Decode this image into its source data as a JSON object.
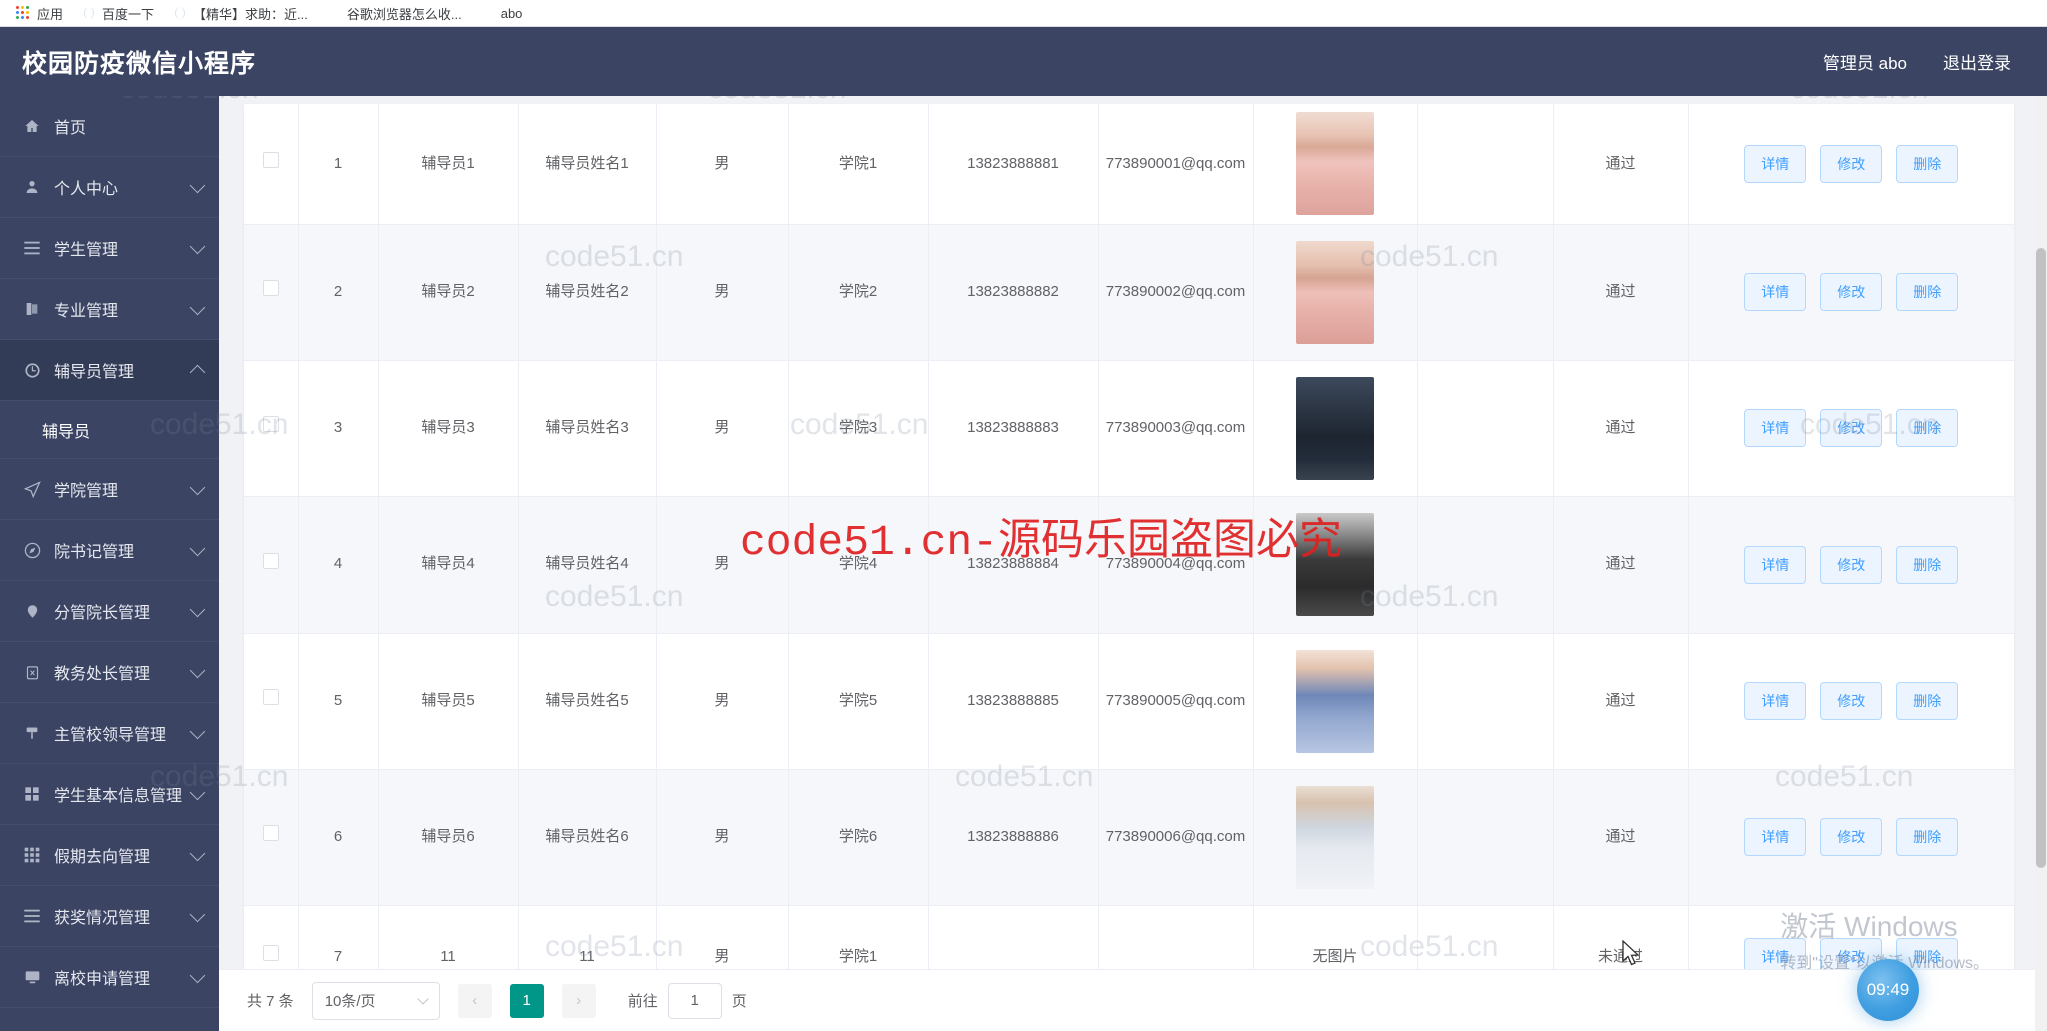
{
  "browser": {
    "bookmarks": [
      {
        "icon": "apps-grid-icon",
        "label": "应用"
      },
      {
        "icon": "globe-icon",
        "label": "百度一下"
      },
      {
        "icon": "globe-icon",
        "label": "【精华】求助：近..."
      },
      {
        "icon": "baidu-icon",
        "label": "谷歌浏览器怎么收..."
      },
      {
        "icon": "folder-icon",
        "label": "abo"
      }
    ]
  },
  "header": {
    "title": "校园防疫微信小程序",
    "admin_label": "管理员 abo",
    "logout_label": "退出登录"
  },
  "sidebar": {
    "items": [
      {
        "label": "首页",
        "icon": "home-icon",
        "expandable": false,
        "active": false,
        "expanded": false
      },
      {
        "label": "个人中心",
        "icon": "user-icon",
        "expandable": true,
        "active": false,
        "expanded": false
      },
      {
        "label": "学生管理",
        "icon": "list-icon",
        "expandable": true,
        "active": false,
        "expanded": false
      },
      {
        "label": "专业管理",
        "icon": "book-icon",
        "expandable": true,
        "active": false,
        "expanded": false
      },
      {
        "label": "辅导员管理",
        "icon": "clock-icon",
        "expandable": true,
        "active": true,
        "expanded": true
      },
      {
        "label": "学院管理",
        "icon": "send-icon",
        "expandable": true,
        "active": false,
        "expanded": false
      },
      {
        "label": "院书记管理",
        "icon": "compass-icon",
        "expandable": true,
        "active": false,
        "expanded": false
      },
      {
        "label": "分管院长管理",
        "icon": "location-icon",
        "expandable": true,
        "active": false,
        "expanded": false
      },
      {
        "label": "教务处长管理",
        "icon": "clipboard-icon",
        "expandable": true,
        "active": false,
        "expanded": false
      },
      {
        "label": "主管校领导管理",
        "icon": "pin-icon",
        "expandable": true,
        "active": false,
        "expanded": false
      },
      {
        "label": "学生基本信息管理",
        "icon": "grid4-icon",
        "expandable": true,
        "active": false,
        "expanded": false
      },
      {
        "label": "假期去向管理",
        "icon": "grid9-icon",
        "expandable": true,
        "active": false,
        "expanded": false
      },
      {
        "label": "获奖情况管理",
        "icon": "list-icon",
        "expandable": true,
        "active": false,
        "expanded": false
      },
      {
        "label": "离校申请管理",
        "icon": "monitor-icon",
        "expandable": true,
        "active": false,
        "expanded": false
      }
    ],
    "submenu": {
      "parent": "辅导员管理",
      "label": "辅导员"
    }
  },
  "table": {
    "no_image_text": "无图片",
    "rows": [
      {
        "id": "1",
        "account": "辅导员1",
        "name": "辅导员姓名1",
        "sex": "男",
        "college": "学院1",
        "phone": "13823888881",
        "email": "773890001@qq.com",
        "photo": "av1",
        "blank": "",
        "status": "通过"
      },
      {
        "id": "2",
        "account": "辅导员2",
        "name": "辅导员姓名2",
        "sex": "男",
        "college": "学院2",
        "phone": "13823888882",
        "email": "773890002@qq.com",
        "photo": "av2",
        "blank": "",
        "status": "通过"
      },
      {
        "id": "3",
        "account": "辅导员3",
        "name": "辅导员姓名3",
        "sex": "男",
        "college": "学院3",
        "phone": "13823888883",
        "email": "773890003@qq.com",
        "photo": "av3",
        "blank": "",
        "status": "通过"
      },
      {
        "id": "4",
        "account": "辅导员4",
        "name": "辅导员姓名4",
        "sex": "男",
        "college": "学院4",
        "phone": "13823888884",
        "email": "773890004@qq.com",
        "photo": "av4",
        "blank": "",
        "status": "通过"
      },
      {
        "id": "5",
        "account": "辅导员5",
        "name": "辅导员姓名5",
        "sex": "男",
        "college": "学院5",
        "phone": "13823888885",
        "email": "773890005@qq.com",
        "photo": "av5",
        "blank": "",
        "status": "通过"
      },
      {
        "id": "6",
        "account": "辅导员6",
        "name": "辅导员姓名6",
        "sex": "男",
        "college": "学院6",
        "phone": "13823888886",
        "email": "773890006@qq.com",
        "photo": "av6",
        "blank": "",
        "status": "通过"
      },
      {
        "id": "7",
        "account": "11",
        "name": "11",
        "sex": "男",
        "college": "学院1",
        "phone": "",
        "email": "",
        "photo": "none",
        "blank": "",
        "status": "未通过"
      }
    ],
    "ops": {
      "detail": "详情",
      "edit": "修改",
      "delete": "删除"
    }
  },
  "pagination": {
    "total_label": "共 7 条",
    "page_size": "10条/页",
    "prev": "‹",
    "next": "›",
    "current_page": "1",
    "jump_label": "前往",
    "jump_value": "1",
    "page_unit": "页"
  },
  "watermarks": {
    "main": "code51.cn-源码乐园盗图必究",
    "tile": "code51.cn"
  },
  "windows_activation": {
    "line1": "激活 Windows",
    "line2": "转到\"设置\"以激活 Windows。"
  },
  "clock": {
    "time": "09:49"
  },
  "colors": {
    "sidebar_bg": "#3b4563",
    "header_bg": "#3b4563",
    "accent_blue": "#409eff",
    "pager_active": "#009688",
    "watermark_red": "#e02020"
  }
}
